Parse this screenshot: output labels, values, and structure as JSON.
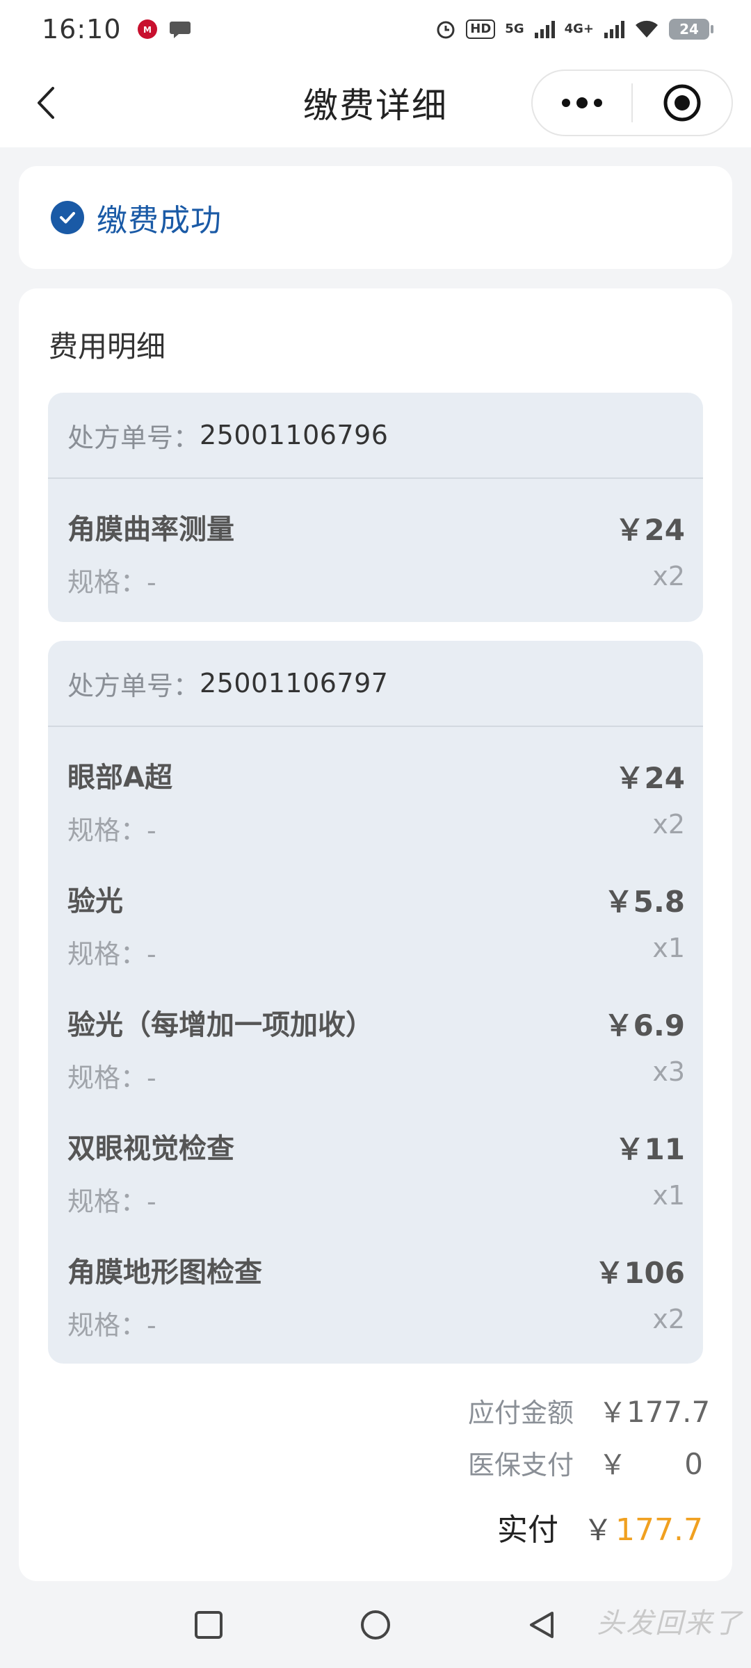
{
  "status_bar": {
    "time": "16:10",
    "hd_tag": "HD",
    "net_5g": "5G",
    "net_4g": "4G+",
    "battery": "24"
  },
  "nav": {
    "title": "缴费详细"
  },
  "status": {
    "text": "缴费成功",
    "accent_color": "#1a5aa6"
  },
  "detail": {
    "title": "费用明细",
    "rx_label": "处方单号：",
    "spec_label": "规格：",
    "prescriptions": [
      {
        "no": "25001106796",
        "items": [
          {
            "name": "角膜曲率测量",
            "price": "￥24",
            "spec": "-",
            "qty": "x2"
          }
        ]
      },
      {
        "no": "25001106797",
        "items": [
          {
            "name": "眼部A超",
            "price": "￥24",
            "spec": "-",
            "qty": "x2"
          },
          {
            "name": "验光",
            "price": "￥5.8",
            "spec": "-",
            "qty": "x1"
          },
          {
            "name": "验光（每增加一项加收）",
            "price": "￥6.9",
            "spec": "-",
            "qty": "x3"
          },
          {
            "name": "双眼视觉检查",
            "price": "￥11",
            "spec": "-",
            "qty": "x1"
          },
          {
            "name": "角膜地形图检查",
            "price": "￥106",
            "spec": "-",
            "qty": "x2"
          }
        ]
      }
    ]
  },
  "summary": {
    "payable_label": "应付金额",
    "payable_yen": "￥",
    "payable_value": "177.7",
    "insurance_label": "医保支付",
    "insurance_yen": "￥",
    "insurance_value": "0",
    "paid_label": "实付",
    "paid_yen": "￥",
    "paid_value": "177.7",
    "paid_color": "#f0a020"
  },
  "watermark": "头发回来了"
}
